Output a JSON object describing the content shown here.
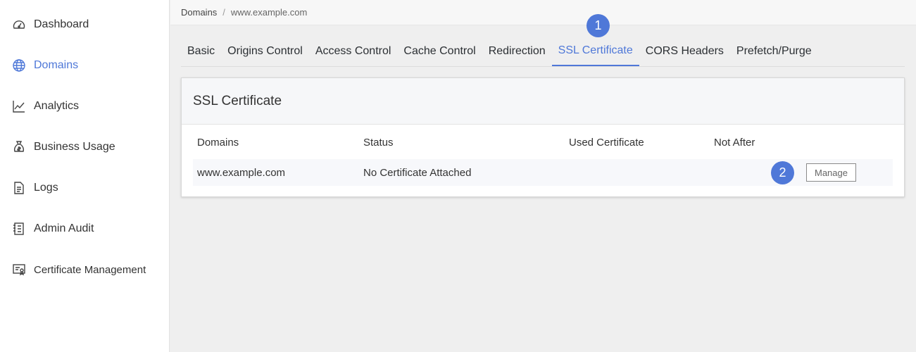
{
  "sidebar": {
    "items": [
      {
        "label": "Dashboard",
        "icon": "gauge-icon"
      },
      {
        "label": "Domains",
        "icon": "globe-icon",
        "active": true
      },
      {
        "label": "Analytics",
        "icon": "chart-line-icon"
      },
      {
        "label": "Business Usage",
        "icon": "money-bag-icon"
      },
      {
        "label": "Logs",
        "icon": "document-icon"
      },
      {
        "label": "Admin Audit",
        "icon": "notebook-icon"
      },
      {
        "label": "Certificate Management",
        "icon": "certificate-icon"
      }
    ]
  },
  "breadcrumb": {
    "root": "Domains",
    "separator": "/",
    "current": "www.example.com"
  },
  "tabs": [
    {
      "label": "Basic"
    },
    {
      "label": "Origins Control"
    },
    {
      "label": "Access Control"
    },
    {
      "label": "Cache Control"
    },
    {
      "label": "Redirection"
    },
    {
      "label": "SSL Certificate",
      "active": true
    },
    {
      "label": "CORS Headers"
    },
    {
      "label": "Prefetch/Purge"
    }
  ],
  "badges": {
    "one": "1",
    "two": "2"
  },
  "panel": {
    "title": "SSL Certificate",
    "columns": [
      "Domains",
      "Status",
      "Used Certificate",
      "Not After"
    ],
    "rows": [
      {
        "domain": "www.example.com",
        "status": "No Certificate Attached",
        "used_certificate": "",
        "not_after": "",
        "action": "Manage"
      }
    ]
  },
  "colors": {
    "accent": "#4f78d8",
    "background": "#efefef"
  }
}
